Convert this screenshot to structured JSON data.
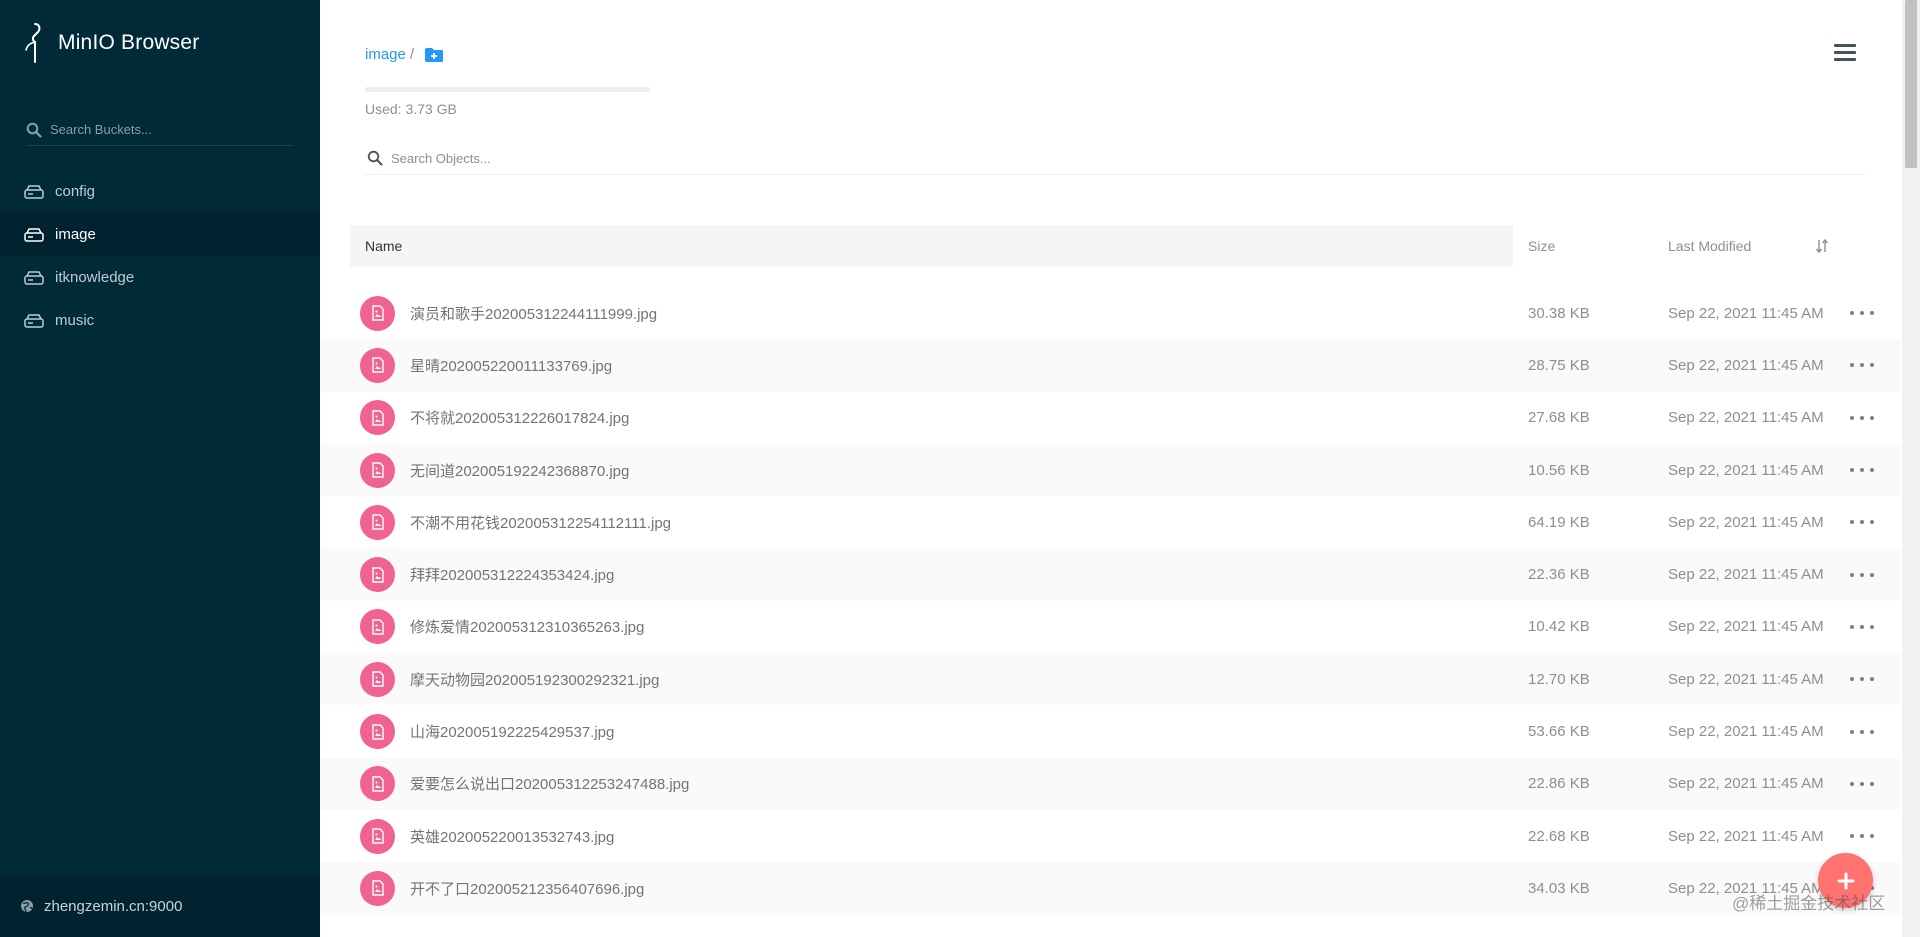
{
  "app": {
    "title": "MinIO Browser"
  },
  "sidebar": {
    "search_placeholder": "Search Buckets...",
    "buckets": [
      {
        "label": "config"
      },
      {
        "label": "image"
      },
      {
        "label": "itknowledge"
      },
      {
        "label": "music"
      }
    ],
    "active_bucket": "image",
    "host": "zhengzemin.cn:9000"
  },
  "header": {
    "breadcrumb": "image",
    "breadcrumb_sep": "/",
    "used_label": "Used: 3.73 GB",
    "search_placeholder": "Search Objects..."
  },
  "table": {
    "columns": {
      "name": "Name",
      "size": "Size",
      "modified": "Last Modified"
    },
    "rows": [
      {
        "name": "演员和歌手202005312244111999.jpg",
        "size": "30.38 KB",
        "modified": "Sep 22, 2021 11:45 AM"
      },
      {
        "name": "星晴202005220011133769.jpg",
        "size": "28.75 KB",
        "modified": "Sep 22, 2021 11:45 AM"
      },
      {
        "name": "不将就202005312226017824.jpg",
        "size": "27.68 KB",
        "modified": "Sep 22, 2021 11:45 AM"
      },
      {
        "name": "无间道202005192242368870.jpg",
        "size": "10.56 KB",
        "modified": "Sep 22, 2021 11:45 AM"
      },
      {
        "name": "不潮不用花钱202005312254112111.jpg",
        "size": "64.19 KB",
        "modified": "Sep 22, 2021 11:45 AM"
      },
      {
        "name": "拜拜202005312224353424.jpg",
        "size": "22.36 KB",
        "modified": "Sep 22, 2021 11:45 AM"
      },
      {
        "name": "修炼爱情202005312310365263.jpg",
        "size": "10.42 KB",
        "modified": "Sep 22, 2021 11:45 AM"
      },
      {
        "name": "摩天动物园202005192300292321.jpg",
        "size": "12.70 KB",
        "modified": "Sep 22, 2021 11:45 AM"
      },
      {
        "name": "山海202005192225429537.jpg",
        "size": "53.66 KB",
        "modified": "Sep 22, 2021 11:45 AM"
      },
      {
        "name": "爱要怎么说出口202005312253247488.jpg",
        "size": "22.86 KB",
        "modified": "Sep 22, 2021 11:45 AM"
      },
      {
        "name": "英雄202005220013532743.jpg",
        "size": "22.68 KB",
        "modified": "Sep 22, 2021 11:45 AM"
      },
      {
        "name": "开不了口202005212356407696.jpg",
        "size": "34.03 KB",
        "modified": "Sep 22, 2021 11:45 AM"
      }
    ]
  },
  "watermark": "@稀土掘金技术社区",
  "icons": {
    "logo": "minio-logo-icon",
    "search": "search-icon",
    "bucket": "hard-drive-icon",
    "host": "globe-icon",
    "new_folder": "folder-plus-icon",
    "menu": "hamburger-menu-icon",
    "sort": "sort-icon",
    "file": "image-file-icon",
    "actions": "more-horizontal-icon",
    "fab": "plus-icon"
  },
  "colors": {
    "sidebar_bg": "#002a37",
    "accent_blue": "#2298f7",
    "file_icon": "#f06292",
    "fab": "#ff726f"
  }
}
